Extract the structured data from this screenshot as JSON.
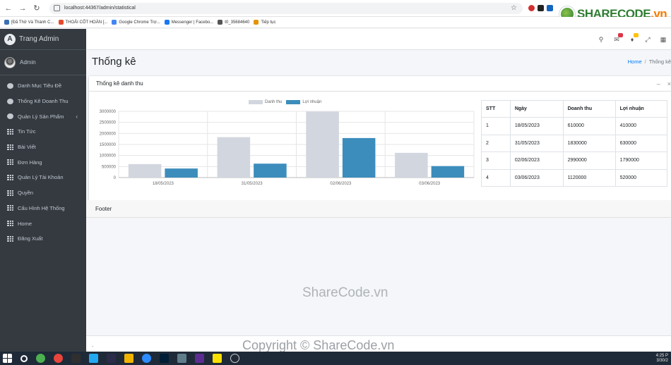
{
  "browser": {
    "url": "localhost:44367/admin/statistical",
    "bookmarks": [
      {
        "label": "[Đã Thử Và Thành C...",
        "color": "#3b6fb6"
      },
      {
        "label": "THOẢI CỐT HOÀN [...",
        "color": "#e34b2c"
      },
      {
        "label": "Google Chrome Trợ...",
        "color": "#4285f4"
      },
      {
        "label": "Messenger | Facebo...",
        "color": "#1877f2"
      },
      {
        "label": "t0_35684640",
        "color": "#555555"
      },
      {
        "label": "Tiếp tục",
        "color": "#e59400"
      }
    ]
  },
  "watermark_logo": {
    "text_main": "SHARECODE",
    "text_tld": ".vn"
  },
  "sidebar": {
    "brand": "Trang Admin",
    "brand_letter": "A",
    "user": "Admin",
    "items": [
      {
        "label": "Danh Mục Tiêu Đề",
        "icon": "gauge"
      },
      {
        "label": "Thống Kê Doanh Thu",
        "icon": "gauge"
      },
      {
        "label": "Quản Lý Sản Phẩm",
        "icon": "gauge",
        "chevron": "‹"
      },
      {
        "label": "Tin Tức",
        "icon": "grid"
      },
      {
        "label": "Bài Viết",
        "icon": "grid"
      },
      {
        "label": "Đơn Hàng",
        "icon": "grid"
      },
      {
        "label": "Quản Lý Tài Khoản",
        "icon": "grid"
      },
      {
        "label": "Quyền",
        "icon": "grid"
      },
      {
        "label": "Cấu Hình Hệ Thống",
        "icon": "grid"
      },
      {
        "label": "Home",
        "icon": "grid"
      },
      {
        "label": "Đăng Xuất",
        "icon": "grid"
      }
    ]
  },
  "header": {
    "title": "Thống kê",
    "breadcrumb_home": "Home",
    "breadcrumb_current": "Thống kê"
  },
  "card": {
    "title": "Thống kê danh thu",
    "minimize": "–",
    "close": "×"
  },
  "chart_data": {
    "type": "bar",
    "categories": [
      "18/05/2023",
      "31/05/2023",
      "02/06/2023",
      "03/06/2023"
    ],
    "series": [
      {
        "name": "Danh thu",
        "values": [
          610000,
          1830000,
          2990000,
          1120000
        ],
        "color": "#d2d6de"
      },
      {
        "name": "Lợi nhuận",
        "values": [
          410000,
          630000,
          1790000,
          520000
        ],
        "color": "#3c8dbc"
      }
    ],
    "ylim": [
      0,
      3000000
    ],
    "yticks": [
      0,
      500000,
      1000000,
      1500000,
      2000000,
      2500000,
      3000000
    ],
    "legend": "top-center",
    "grid": true
  },
  "table": {
    "headers": [
      "STT",
      "Ngày",
      "Doanh thu",
      "Lợi nhuận"
    ],
    "rows": [
      [
        "1",
        "18/05/2023",
        "610000",
        "410000"
      ],
      [
        "2",
        "31/05/2023",
        "1830000",
        "630000"
      ],
      [
        "3",
        "02/06/2023",
        "2990000",
        "1790000"
      ],
      [
        "4",
        "03/06/2023",
        "1120000",
        "520000"
      ]
    ]
  },
  "footer_strip": "Footer",
  "main_footer": ".",
  "overlay": {
    "sharecode": "ShareCode.vn",
    "copyright": "Copyright © ShareCode.vn"
  },
  "taskbar": {
    "clock_time": "4:25 P",
    "clock_date": "3/30/2"
  }
}
